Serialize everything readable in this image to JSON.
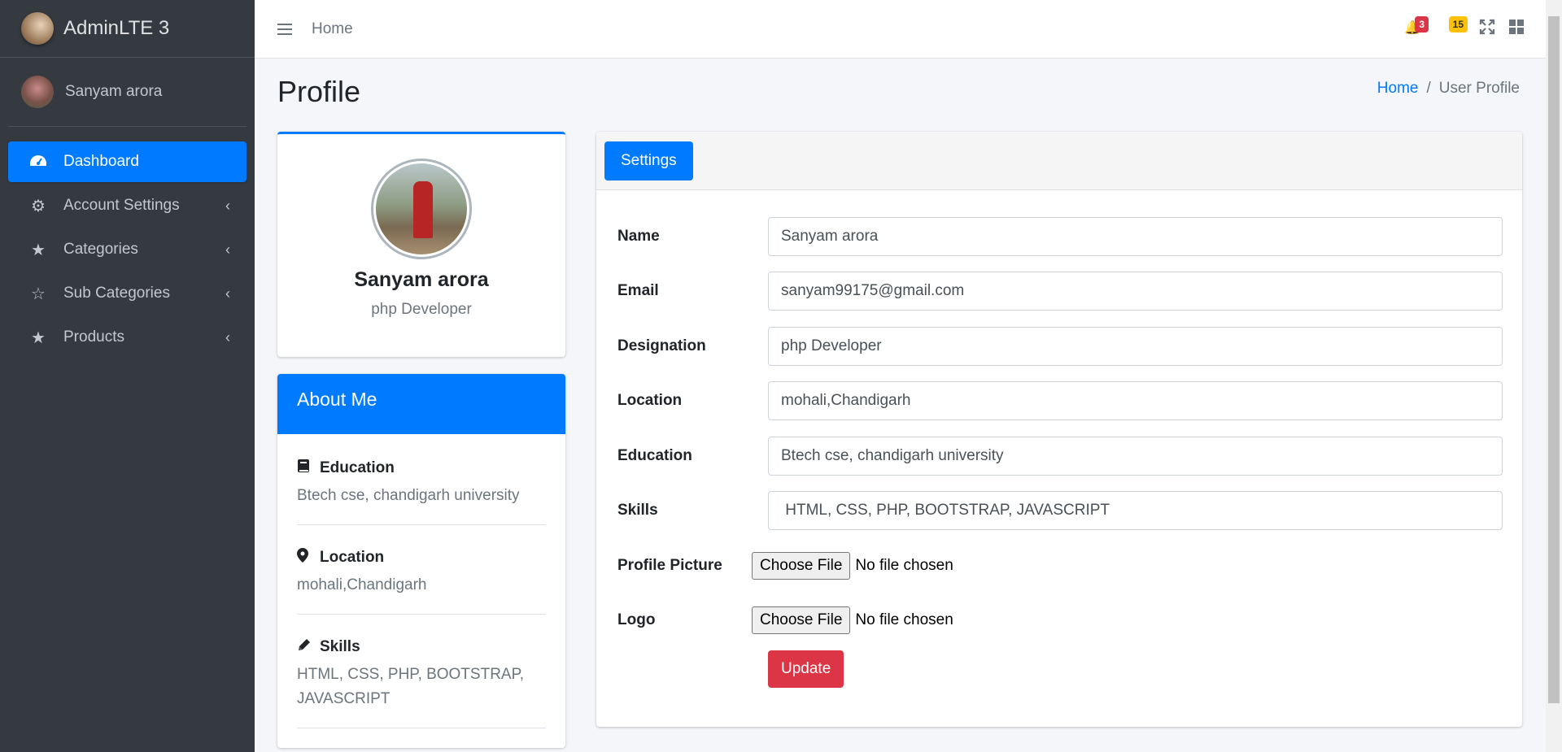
{
  "brand": {
    "name": "AdminLTE 3"
  },
  "user": {
    "name": "Sanyam arora"
  },
  "sidebar": {
    "items": [
      {
        "label": "Dashboard",
        "icon": "dashboard-icon",
        "active": true
      },
      {
        "label": "Account Settings",
        "icon": "gear-icon"
      },
      {
        "label": "Categories",
        "icon": "star-icon"
      },
      {
        "label": "Sub Categories",
        "icon": "star-half-icon"
      },
      {
        "label": "Products",
        "icon": "star-icon"
      }
    ]
  },
  "topbar": {
    "home_label": "Home",
    "notifications_count": "3",
    "messages_count": "15"
  },
  "page": {
    "title": "Profile"
  },
  "breadcrumb": {
    "home": "Home",
    "separator": "/",
    "current": "User Profile"
  },
  "profile": {
    "name": "Sanyam arora",
    "role": "php Developer"
  },
  "about": {
    "title": "About Me",
    "items": [
      {
        "label": "Education",
        "value": "Btech cse, chandigarh university"
      },
      {
        "label": "Location",
        "value": "mohali,Chandigarh"
      },
      {
        "label": "Skills",
        "value": "HTML, CSS, PHP, BOOTSTRAP, JAVASCRIPT"
      }
    ]
  },
  "settings": {
    "tab_label": "Settings",
    "fields": {
      "name_label": "Name",
      "name_value": "Sanyam arora",
      "email_label": "Email",
      "email_value": "sanyam99175@gmail.com",
      "designation_label": "Designation",
      "designation_value": "php Developer",
      "location_label": "Location",
      "location_value": "mohali,Chandigarh",
      "education_label": "Education",
      "education_value": "Btech cse, chandigarh university",
      "skills_label": "Skills",
      "skills_value": " HTML, CSS, PHP, BOOTSTRAP, JAVASCRIPT",
      "picture_label": "Profile Picture",
      "logo_label": "Logo",
      "choose_file": "Choose File",
      "no_file": "No file chosen"
    },
    "update_label": "Update"
  },
  "colors": {
    "primary": "#007bff",
    "danger": "#dc3545",
    "warning": "#ffc107",
    "sidebar": "#343a40"
  }
}
